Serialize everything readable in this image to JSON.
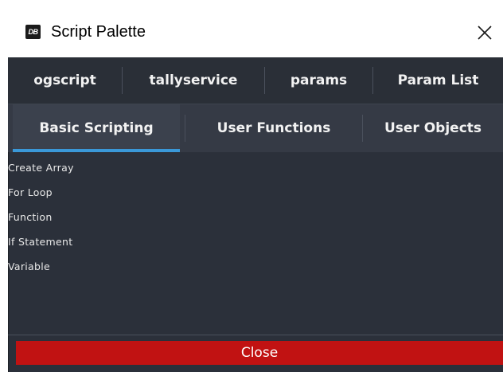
{
  "window": {
    "title": "Script Palette",
    "app_icon_text": "DB"
  },
  "tabs_top": [
    {
      "label": "ogscript"
    },
    {
      "label": "tallyservice"
    },
    {
      "label": "params"
    },
    {
      "label": "Param List"
    }
  ],
  "tabs_sub": [
    {
      "label": "Basic Scripting",
      "active": true
    },
    {
      "label": "User Functions",
      "active": false
    },
    {
      "label": "User Objects",
      "active": false
    }
  ],
  "items": [
    {
      "label": "Create Array"
    },
    {
      "label": "For Loop"
    },
    {
      "label": "Function"
    },
    {
      "label": "If Statement"
    },
    {
      "label": "Variable"
    }
  ],
  "footer": {
    "close_label": "Close"
  },
  "colors": {
    "panel_bg": "#2b303a",
    "tab_bar_bg": "#2a2f37",
    "sub_tab_bar_bg": "#353a45",
    "active_underline": "#3a98d8",
    "close_button": "#c11212"
  }
}
